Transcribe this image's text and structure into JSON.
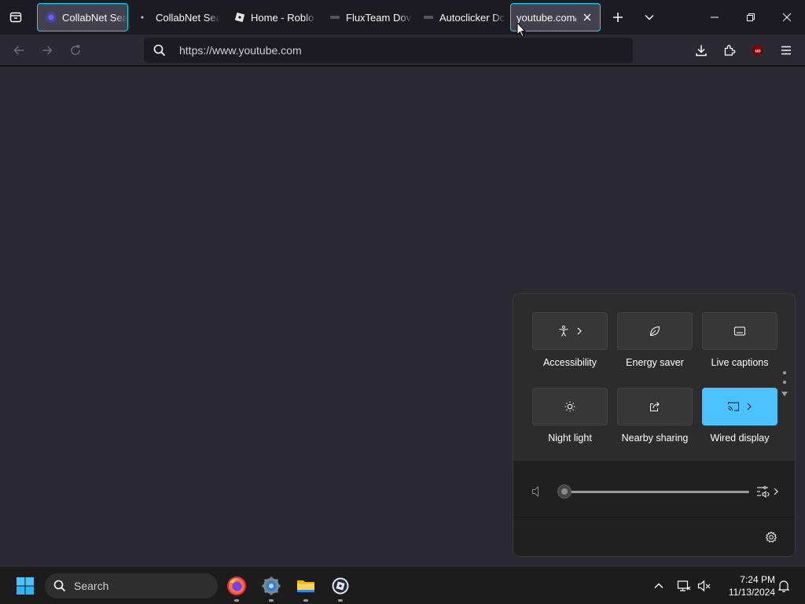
{
  "browser": {
    "tabs": [
      {
        "title": "CollabNet Sea",
        "favicon": "collabnet-logo"
      },
      {
        "title": "CollabNet Sea",
        "favicon": "dot"
      },
      {
        "title": "Home - Roblo",
        "favicon": "roblox-logo"
      },
      {
        "title": "FluxTeam Dov",
        "favicon": "fluxteam-logo"
      },
      {
        "title": "Autoclicker Dc",
        "favicon": "autoclicker-logo"
      },
      {
        "title": "youtube.com/",
        "favicon": "none",
        "active": true
      }
    ],
    "url": {
      "value": "",
      "placeholder": "https://www.youtube.com"
    },
    "accent_color": "#00ddff"
  },
  "quick_settings": {
    "tiles": [
      {
        "label": "Accessibility",
        "icon": "accessibility-icon",
        "has_chevron": true,
        "on": false
      },
      {
        "label": "Energy saver",
        "icon": "leaf-icon",
        "has_chevron": false,
        "on": false
      },
      {
        "label": "Live captions",
        "icon": "captions-icon",
        "has_chevron": false,
        "on": false
      },
      {
        "label": "Night light",
        "icon": "brightness-icon",
        "has_chevron": false,
        "on": false
      },
      {
        "label": "Nearby sharing",
        "icon": "share-icon",
        "has_chevron": false,
        "on": false
      },
      {
        "label": "Wired display",
        "icon": "cast-icon",
        "has_chevron": true,
        "on": true
      }
    ],
    "volume_level": 0,
    "active_color": "#4cc2ff"
  },
  "taskbar": {
    "search_label": "Search",
    "apps": [
      "firefox-icon",
      "settings-app-icon",
      "file-explorer-icon",
      "roblox-studio-icon"
    ],
    "time": "7:24 PM",
    "date": "11/13/2024"
  }
}
